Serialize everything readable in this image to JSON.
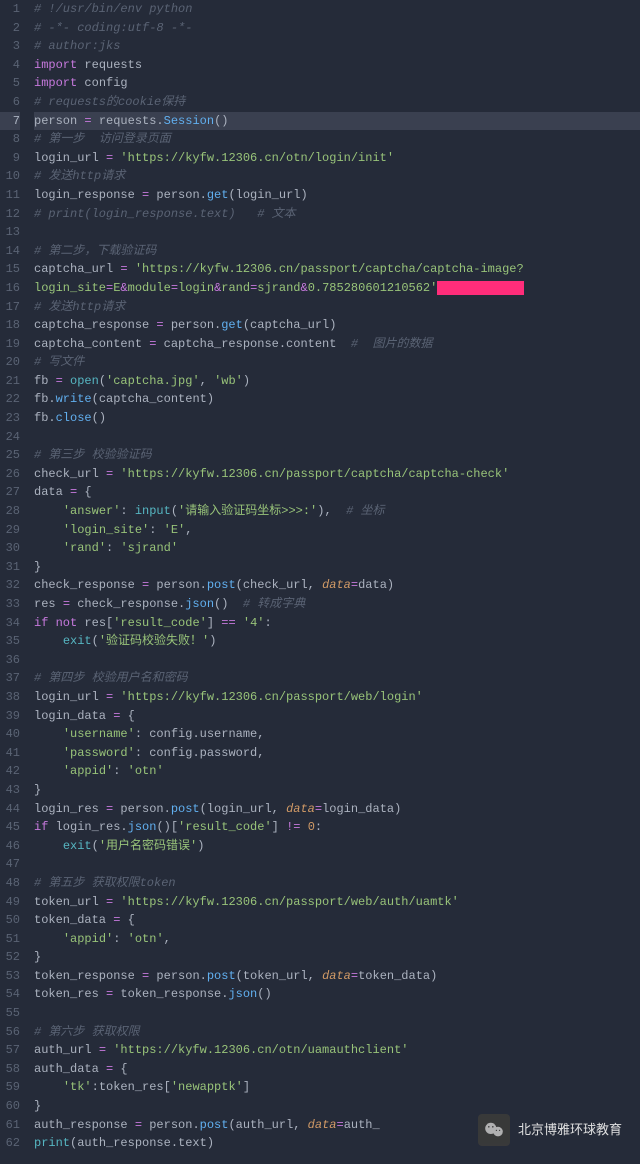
{
  "watermark": {
    "text": "北京博雅环球教育"
  },
  "activeLine": 7,
  "lines": [
    {
      "n": 1,
      "seg": [
        {
          "cls": "c-comment",
          "t": "# !/usr/bin/env python"
        }
      ]
    },
    {
      "n": 2,
      "seg": [
        {
          "cls": "c-comment",
          "t": "# -*- coding:utf-8 -*-"
        }
      ]
    },
    {
      "n": 3,
      "seg": [
        {
          "cls": "c-comment",
          "t": "# author:jks"
        }
      ]
    },
    {
      "n": 4,
      "seg": [
        {
          "cls": "c-keyword",
          "t": "import"
        },
        {
          "cls": "c-plain",
          "t": " requests"
        }
      ]
    },
    {
      "n": 5,
      "seg": [
        {
          "cls": "c-keyword",
          "t": "import"
        },
        {
          "cls": "c-plain",
          "t": " config"
        }
      ]
    },
    {
      "n": 6,
      "seg": [
        {
          "cls": "c-comment",
          "t": "# requests的cookie保持"
        }
      ]
    },
    {
      "n": 7,
      "seg": [
        {
          "cls": "c-plain",
          "t": "person "
        },
        {
          "cls": "c-op",
          "t": "="
        },
        {
          "cls": "c-plain",
          "t": " requests."
        },
        {
          "cls": "c-func2",
          "t": "Session"
        },
        {
          "cls": "c-plain",
          "t": "()"
        }
      ]
    },
    {
      "n": 8,
      "seg": [
        {
          "cls": "c-comment",
          "t": "# 第一步  访问登录页面"
        }
      ]
    },
    {
      "n": 9,
      "seg": [
        {
          "cls": "c-plain",
          "t": "login_url "
        },
        {
          "cls": "c-op",
          "t": "="
        },
        {
          "cls": "c-plain",
          "t": " "
        },
        {
          "cls": "c-string",
          "t": "'https://kyfw.12306.cn/otn/login/init'"
        }
      ]
    },
    {
      "n": 10,
      "seg": [
        {
          "cls": "c-comment",
          "t": "# 发送http请求"
        }
      ]
    },
    {
      "n": 11,
      "seg": [
        {
          "cls": "c-plain",
          "t": "login_response "
        },
        {
          "cls": "c-op",
          "t": "="
        },
        {
          "cls": "c-plain",
          "t": " person."
        },
        {
          "cls": "c-func2",
          "t": "get"
        },
        {
          "cls": "c-plain",
          "t": "(login_url)"
        }
      ]
    },
    {
      "n": 12,
      "seg": [
        {
          "cls": "c-comment",
          "t": "# print(login_response.text)   # 文本"
        }
      ]
    },
    {
      "n": 13,
      "seg": []
    },
    {
      "n": 14,
      "seg": [
        {
          "cls": "c-comment",
          "t": "# 第二步，下载验证码"
        }
      ]
    },
    {
      "n": 15,
      "seg": [
        {
          "cls": "c-plain",
          "t": "captcha_url "
        },
        {
          "cls": "c-op",
          "t": "="
        },
        {
          "cls": "c-plain",
          "t": " "
        },
        {
          "cls": "c-string",
          "t": "'https://kyfw.12306.cn/passport/captcha/captcha-image?"
        }
      ]
    },
    {
      "n": 16,
      "seg": [
        {
          "cls": "c-string",
          "t": "login_site"
        },
        {
          "cls": "c-op",
          "t": "="
        },
        {
          "cls": "c-string",
          "t": "E"
        },
        {
          "cls": "c-op",
          "t": "&"
        },
        {
          "cls": "c-string",
          "t": "module"
        },
        {
          "cls": "c-op",
          "t": "="
        },
        {
          "cls": "c-string",
          "t": "login"
        },
        {
          "cls": "c-op",
          "t": "&"
        },
        {
          "cls": "c-string",
          "t": "rand"
        },
        {
          "cls": "c-op",
          "t": "="
        },
        {
          "cls": "c-string",
          "t": "sjrand"
        },
        {
          "cls": "c-op",
          "t": "&"
        },
        {
          "cls": "c-string",
          "t": "0.785280601210562'"
        },
        {
          "cls": "hilite",
          "t": "            "
        }
      ]
    },
    {
      "n": 17,
      "seg": [
        {
          "cls": "c-comment",
          "t": "# 发送http请求"
        }
      ]
    },
    {
      "n": 18,
      "seg": [
        {
          "cls": "c-plain",
          "t": "captcha_response "
        },
        {
          "cls": "c-op",
          "t": "="
        },
        {
          "cls": "c-plain",
          "t": " person."
        },
        {
          "cls": "c-func2",
          "t": "get"
        },
        {
          "cls": "c-plain",
          "t": "(captcha_url)"
        }
      ]
    },
    {
      "n": 19,
      "seg": [
        {
          "cls": "c-plain",
          "t": "captcha_content "
        },
        {
          "cls": "c-op",
          "t": "="
        },
        {
          "cls": "c-plain",
          "t": " captcha_response.content "
        },
        {
          "cls": "c-comment",
          "t": " #  图片的数据"
        }
      ]
    },
    {
      "n": 20,
      "seg": [
        {
          "cls": "c-comment",
          "t": "# 写文件"
        }
      ]
    },
    {
      "n": 21,
      "seg": [
        {
          "cls": "c-plain",
          "t": "fb "
        },
        {
          "cls": "c-op",
          "t": "="
        },
        {
          "cls": "c-plain",
          "t": " "
        },
        {
          "cls": "c-func",
          "t": "open"
        },
        {
          "cls": "c-plain",
          "t": "("
        },
        {
          "cls": "c-string",
          "t": "'captcha.jpg'"
        },
        {
          "cls": "c-plain",
          "t": ", "
        },
        {
          "cls": "c-string",
          "t": "'wb'"
        },
        {
          "cls": "c-plain",
          "t": ")"
        }
      ]
    },
    {
      "n": 22,
      "seg": [
        {
          "cls": "c-plain",
          "t": "fb."
        },
        {
          "cls": "c-func2",
          "t": "write"
        },
        {
          "cls": "c-plain",
          "t": "(captcha_content)"
        }
      ]
    },
    {
      "n": 23,
      "seg": [
        {
          "cls": "c-plain",
          "t": "fb."
        },
        {
          "cls": "c-func2",
          "t": "close"
        },
        {
          "cls": "c-plain",
          "t": "()"
        }
      ]
    },
    {
      "n": 24,
      "seg": []
    },
    {
      "n": 25,
      "seg": [
        {
          "cls": "c-comment",
          "t": "# 第三步 校验验证码"
        }
      ]
    },
    {
      "n": 26,
      "seg": [
        {
          "cls": "c-plain",
          "t": "check_url "
        },
        {
          "cls": "c-op",
          "t": "="
        },
        {
          "cls": "c-plain",
          "t": " "
        },
        {
          "cls": "c-string",
          "t": "'https://kyfw.12306.cn/passport/captcha/captcha-check'"
        }
      ]
    },
    {
      "n": 27,
      "seg": [
        {
          "cls": "c-plain",
          "t": "data "
        },
        {
          "cls": "c-op",
          "t": "="
        },
        {
          "cls": "c-plain",
          "t": " {"
        }
      ]
    },
    {
      "n": 28,
      "seg": [
        {
          "cls": "c-plain",
          "t": "    "
        },
        {
          "cls": "c-string",
          "t": "'answer'"
        },
        {
          "cls": "c-plain",
          "t": ": "
        },
        {
          "cls": "c-func",
          "t": "input"
        },
        {
          "cls": "c-plain",
          "t": "("
        },
        {
          "cls": "c-string",
          "t": "'请输入验证码坐标>>>:'"
        },
        {
          "cls": "c-plain",
          "t": "),  "
        },
        {
          "cls": "c-comment",
          "t": "# 坐标"
        }
      ]
    },
    {
      "n": 29,
      "seg": [
        {
          "cls": "c-plain",
          "t": "    "
        },
        {
          "cls": "c-string",
          "t": "'login_site'"
        },
        {
          "cls": "c-plain",
          "t": ": "
        },
        {
          "cls": "c-string",
          "t": "'E'"
        },
        {
          "cls": "c-plain",
          "t": ","
        }
      ]
    },
    {
      "n": 30,
      "seg": [
        {
          "cls": "c-plain",
          "t": "    "
        },
        {
          "cls": "c-string",
          "t": "'rand'"
        },
        {
          "cls": "c-plain",
          "t": ": "
        },
        {
          "cls": "c-string",
          "t": "'sjrand'"
        }
      ]
    },
    {
      "n": 31,
      "seg": [
        {
          "cls": "c-plain",
          "t": "}"
        }
      ]
    },
    {
      "n": 32,
      "seg": [
        {
          "cls": "c-plain",
          "t": "check_response "
        },
        {
          "cls": "c-op",
          "t": "="
        },
        {
          "cls": "c-plain",
          "t": " person."
        },
        {
          "cls": "c-func2",
          "t": "post"
        },
        {
          "cls": "c-plain",
          "t": "(check_url, "
        },
        {
          "cls": "c-param",
          "t": "data"
        },
        {
          "cls": "c-op",
          "t": "="
        },
        {
          "cls": "c-plain",
          "t": "data)"
        }
      ]
    },
    {
      "n": 33,
      "seg": [
        {
          "cls": "c-plain",
          "t": "res "
        },
        {
          "cls": "c-op",
          "t": "="
        },
        {
          "cls": "c-plain",
          "t": " check_response."
        },
        {
          "cls": "c-func2",
          "t": "json"
        },
        {
          "cls": "c-plain",
          "t": "() "
        },
        {
          "cls": "c-comment",
          "t": " # 转成字典"
        }
      ]
    },
    {
      "n": 34,
      "seg": [
        {
          "cls": "c-keyword",
          "t": "if"
        },
        {
          "cls": "c-plain",
          "t": " "
        },
        {
          "cls": "c-keyword",
          "t": "not"
        },
        {
          "cls": "c-plain",
          "t": " res["
        },
        {
          "cls": "c-string",
          "t": "'result_code'"
        },
        {
          "cls": "c-plain",
          "t": "] "
        },
        {
          "cls": "c-op",
          "t": "=="
        },
        {
          "cls": "c-plain",
          "t": " "
        },
        {
          "cls": "c-string",
          "t": "'4'"
        },
        {
          "cls": "c-plain",
          "t": ":"
        }
      ]
    },
    {
      "n": 35,
      "seg": [
        {
          "cls": "c-plain",
          "t": "    "
        },
        {
          "cls": "c-func",
          "t": "exit"
        },
        {
          "cls": "c-plain",
          "t": "("
        },
        {
          "cls": "c-string",
          "t": "'验证码校验失败！'"
        },
        {
          "cls": "c-plain",
          "t": ")"
        }
      ]
    },
    {
      "n": 36,
      "seg": []
    },
    {
      "n": 37,
      "seg": [
        {
          "cls": "c-comment",
          "t": "# 第四步 校验用户名和密码"
        }
      ]
    },
    {
      "n": 38,
      "seg": [
        {
          "cls": "c-plain",
          "t": "login_url "
        },
        {
          "cls": "c-op",
          "t": "="
        },
        {
          "cls": "c-plain",
          "t": " "
        },
        {
          "cls": "c-string",
          "t": "'https://kyfw.12306.cn/passport/web/login'"
        }
      ]
    },
    {
      "n": 39,
      "seg": [
        {
          "cls": "c-plain",
          "t": "login_data "
        },
        {
          "cls": "c-op",
          "t": "="
        },
        {
          "cls": "c-plain",
          "t": " {"
        }
      ]
    },
    {
      "n": 40,
      "seg": [
        {
          "cls": "c-plain",
          "t": "    "
        },
        {
          "cls": "c-string",
          "t": "'username'"
        },
        {
          "cls": "c-plain",
          "t": ": config.username,"
        }
      ]
    },
    {
      "n": 41,
      "seg": [
        {
          "cls": "c-plain",
          "t": "    "
        },
        {
          "cls": "c-string",
          "t": "'password'"
        },
        {
          "cls": "c-plain",
          "t": ": config.password,"
        }
      ]
    },
    {
      "n": 42,
      "seg": [
        {
          "cls": "c-plain",
          "t": "    "
        },
        {
          "cls": "c-string",
          "t": "'appid'"
        },
        {
          "cls": "c-plain",
          "t": ": "
        },
        {
          "cls": "c-string",
          "t": "'otn'"
        }
      ]
    },
    {
      "n": 43,
      "seg": [
        {
          "cls": "c-plain",
          "t": "}"
        }
      ]
    },
    {
      "n": 44,
      "seg": [
        {
          "cls": "c-plain",
          "t": "login_res "
        },
        {
          "cls": "c-op",
          "t": "="
        },
        {
          "cls": "c-plain",
          "t": " person."
        },
        {
          "cls": "c-func2",
          "t": "post"
        },
        {
          "cls": "c-plain",
          "t": "(login_url, "
        },
        {
          "cls": "c-param",
          "t": "data"
        },
        {
          "cls": "c-op",
          "t": "="
        },
        {
          "cls": "c-plain",
          "t": "login_data)"
        }
      ]
    },
    {
      "n": 45,
      "seg": [
        {
          "cls": "c-keyword",
          "t": "if"
        },
        {
          "cls": "c-plain",
          "t": " login_res."
        },
        {
          "cls": "c-func2",
          "t": "json"
        },
        {
          "cls": "c-plain",
          "t": "()["
        },
        {
          "cls": "c-string",
          "t": "'result_code'"
        },
        {
          "cls": "c-plain",
          "t": "] "
        },
        {
          "cls": "c-op",
          "t": "!="
        },
        {
          "cls": "c-plain",
          "t": " "
        },
        {
          "cls": "c-num",
          "t": "0"
        },
        {
          "cls": "c-plain",
          "t": ":"
        }
      ]
    },
    {
      "n": 46,
      "seg": [
        {
          "cls": "c-plain",
          "t": "    "
        },
        {
          "cls": "c-func",
          "t": "exit"
        },
        {
          "cls": "c-plain",
          "t": "("
        },
        {
          "cls": "c-string",
          "t": "'用户名密码错误'"
        },
        {
          "cls": "c-plain",
          "t": ")"
        }
      ]
    },
    {
      "n": 47,
      "seg": []
    },
    {
      "n": 48,
      "seg": [
        {
          "cls": "c-comment",
          "t": "# 第五步 获取权限token"
        }
      ]
    },
    {
      "n": 49,
      "seg": [
        {
          "cls": "c-plain",
          "t": "token_url "
        },
        {
          "cls": "c-op",
          "t": "="
        },
        {
          "cls": "c-plain",
          "t": " "
        },
        {
          "cls": "c-string",
          "t": "'https://kyfw.12306.cn/passport/web/auth/uamtk'"
        }
      ]
    },
    {
      "n": 50,
      "seg": [
        {
          "cls": "c-plain",
          "t": "token_data "
        },
        {
          "cls": "c-op",
          "t": "="
        },
        {
          "cls": "c-plain",
          "t": " {"
        }
      ]
    },
    {
      "n": 51,
      "seg": [
        {
          "cls": "c-plain",
          "t": "    "
        },
        {
          "cls": "c-string",
          "t": "'appid'"
        },
        {
          "cls": "c-plain",
          "t": ": "
        },
        {
          "cls": "c-string",
          "t": "'otn'"
        },
        {
          "cls": "c-plain",
          "t": ","
        }
      ]
    },
    {
      "n": 52,
      "seg": [
        {
          "cls": "c-plain",
          "t": "}"
        }
      ]
    },
    {
      "n": 53,
      "seg": [
        {
          "cls": "c-plain",
          "t": "token_response "
        },
        {
          "cls": "c-op",
          "t": "="
        },
        {
          "cls": "c-plain",
          "t": " person."
        },
        {
          "cls": "c-func2",
          "t": "post"
        },
        {
          "cls": "c-plain",
          "t": "(token_url, "
        },
        {
          "cls": "c-param",
          "t": "data"
        },
        {
          "cls": "c-op",
          "t": "="
        },
        {
          "cls": "c-plain",
          "t": "token_data)"
        }
      ]
    },
    {
      "n": 54,
      "seg": [
        {
          "cls": "c-plain",
          "t": "token_res "
        },
        {
          "cls": "c-op",
          "t": "="
        },
        {
          "cls": "c-plain",
          "t": " token_response."
        },
        {
          "cls": "c-func2",
          "t": "json"
        },
        {
          "cls": "c-plain",
          "t": "()"
        }
      ]
    },
    {
      "n": 55,
      "seg": []
    },
    {
      "n": 56,
      "seg": [
        {
          "cls": "c-comment",
          "t": "# 第六步 获取权限"
        }
      ]
    },
    {
      "n": 57,
      "seg": [
        {
          "cls": "c-plain",
          "t": "auth_url "
        },
        {
          "cls": "c-op",
          "t": "="
        },
        {
          "cls": "c-plain",
          "t": " "
        },
        {
          "cls": "c-string",
          "t": "'https://kyfw.12306.cn/otn/uamauthclient'"
        }
      ]
    },
    {
      "n": 58,
      "seg": [
        {
          "cls": "c-plain",
          "t": "auth_data "
        },
        {
          "cls": "c-op",
          "t": "="
        },
        {
          "cls": "c-plain",
          "t": " {"
        }
      ]
    },
    {
      "n": 59,
      "seg": [
        {
          "cls": "c-plain",
          "t": "    "
        },
        {
          "cls": "c-string",
          "t": "'tk'"
        },
        {
          "cls": "c-plain",
          "t": ":token_res["
        },
        {
          "cls": "c-string",
          "t": "'newapptk'"
        },
        {
          "cls": "c-plain",
          "t": "]"
        }
      ]
    },
    {
      "n": 60,
      "seg": [
        {
          "cls": "c-plain",
          "t": "}"
        }
      ]
    },
    {
      "n": 61,
      "seg": [
        {
          "cls": "c-plain",
          "t": "auth_response "
        },
        {
          "cls": "c-op",
          "t": "="
        },
        {
          "cls": "c-plain",
          "t": " person."
        },
        {
          "cls": "c-func2",
          "t": "post"
        },
        {
          "cls": "c-plain",
          "t": "(auth_url, "
        },
        {
          "cls": "c-param",
          "t": "data"
        },
        {
          "cls": "c-op",
          "t": "="
        },
        {
          "cls": "c-plain",
          "t": "auth_"
        }
      ]
    },
    {
      "n": 62,
      "seg": [
        {
          "cls": "c-func",
          "t": "print"
        },
        {
          "cls": "c-plain",
          "t": "(auth_response.text)"
        }
      ]
    }
  ]
}
